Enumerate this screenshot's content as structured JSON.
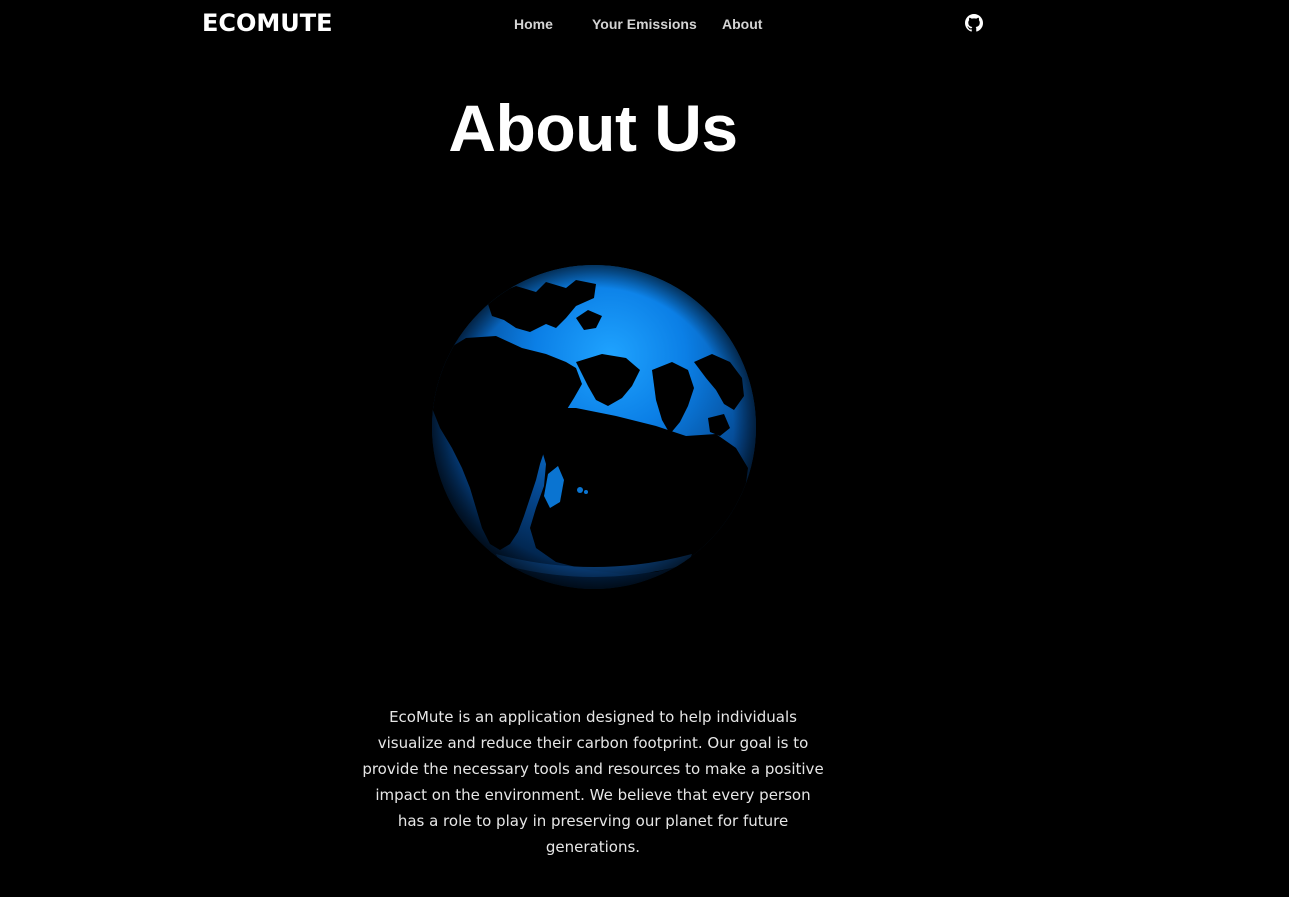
{
  "nav": {
    "brand": "ECOMUTE",
    "links": {
      "home": "Home",
      "emissions": "Your Emissions",
      "about": "About"
    },
    "github_icon": "github-icon"
  },
  "main": {
    "title": "About Us",
    "globe_icon": "globe-image",
    "description": "EcoMute is an application designed to help individuals visualize and reduce their carbon footprint. Our goal is to provide the necessary tools and resources to make a positive impact on the environment. We believe that every person has a role to play in preserving our planet for future generations."
  },
  "colors": {
    "background": "#000000",
    "globe_ocean": "#0a8cff",
    "text": "#ffffff"
  }
}
